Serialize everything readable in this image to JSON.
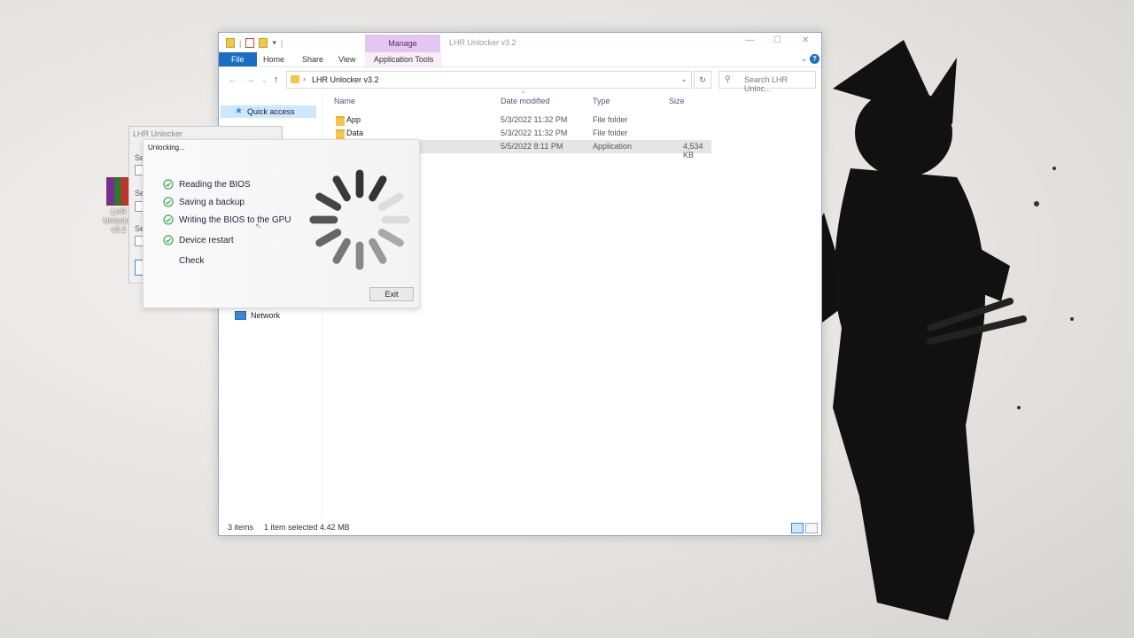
{
  "desktop": {
    "icon_label": "LHR Unlocker v3.2"
  },
  "explorer": {
    "title": "LHR Unlocker v3.2",
    "manage_tab": "Manage",
    "ribbon_tabs": [
      "File",
      "Home",
      "Share",
      "View",
      "Application Tools"
    ],
    "address_path": "LHR Unlocker v3.2",
    "search_placeholder": "Search LHR Unloc...",
    "nav": {
      "quick_access": "Quick access",
      "network": "Network"
    },
    "columns": {
      "name": "Name",
      "date": "Date modified",
      "type": "Type",
      "size": "Size"
    },
    "rows": [
      {
        "name": "App",
        "date": "5/3/2022 11:32 PM",
        "type": "File folder",
        "size": ""
      },
      {
        "name": "Data",
        "date": "5/3/2022 11:32 PM",
        "type": "File folder",
        "size": ""
      },
      {
        "name": "",
        "date": "5/5/2022 8:11 PM",
        "type": "Application",
        "size": "4,534 KB"
      }
    ],
    "status": {
      "items": "3 items",
      "selected": "1 item selected  4.42 MB"
    }
  },
  "lhr_window": {
    "title": "LHR Unlocker"
  },
  "dialog": {
    "title": "Unlocking...",
    "steps": [
      {
        "label": "Reading the BIOS",
        "done": true
      },
      {
        "label": "Saving a backup",
        "done": true
      },
      {
        "label": "Writing the BIOS to the GPU",
        "done": true
      },
      {
        "label": "Device restart",
        "done": true
      },
      {
        "label": "Check",
        "done": false
      }
    ],
    "exit_label": "Exit"
  },
  "colors": {
    "accent": "#1a6ec3",
    "check_green": "#3daa52",
    "manage_tab": "#e3c7ee"
  }
}
